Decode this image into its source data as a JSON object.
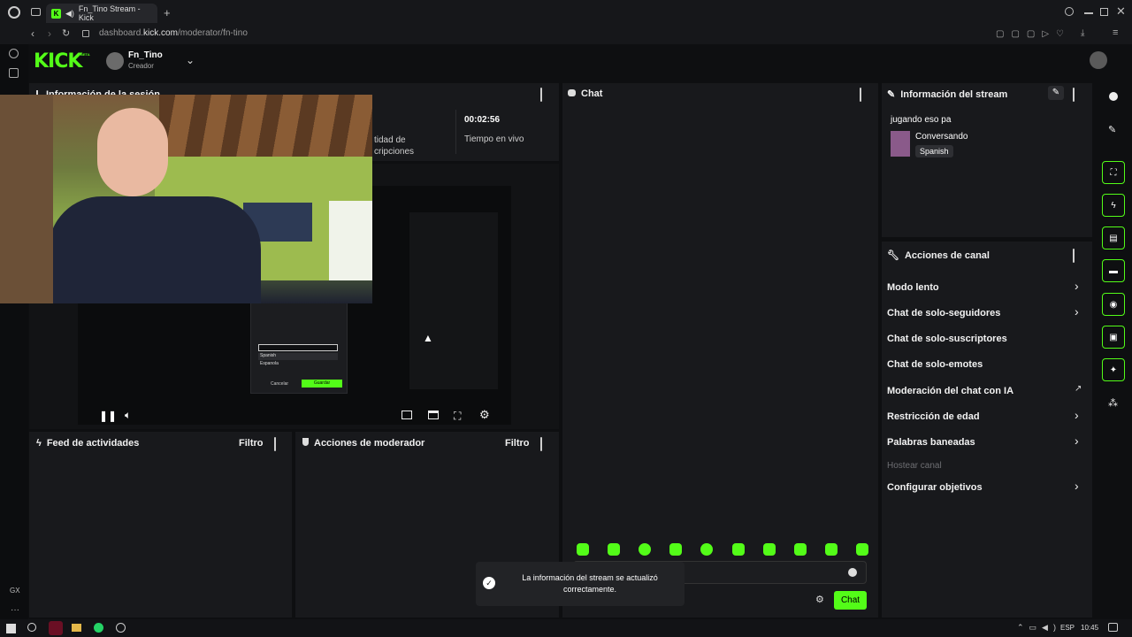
{
  "browser": {
    "tab_title": "Fn_Tino Stream - Kick",
    "new_tab": "+",
    "url_prefix": "dashboard.",
    "url_domain": "kick.com",
    "url_path": "/moderator/fn-tino"
  },
  "header": {
    "logo": "KICK",
    "logo_badge": "BETA",
    "user_name": "Fn_Tino",
    "user_role": "Creador"
  },
  "session": {
    "title": "Información de la sesión",
    "timer": "00:02:56",
    "timer_label": "Tiempo en vivo",
    "subs_label_line1": "tidad de",
    "subs_label_line2": "cripciones"
  },
  "player": {
    "inner_select_value": "Spanish",
    "inner_option_1": "Spanish",
    "inner_option_2": "Espanola",
    "inner_cancel": "Cancelar",
    "inner_save": "Guardar"
  },
  "activity": {
    "title": "Feed de actividades",
    "filter": "Filtro"
  },
  "mod_actions": {
    "title": "Acciones de moderador",
    "filter": "Filtro"
  },
  "chat": {
    "title": "Chat",
    "send_label": "Chat"
  },
  "toast": {
    "line1": "La información del stream se actualizó",
    "line2": "correctamente."
  },
  "stream_info": {
    "title": "Información del stream",
    "stream_title": "jugando eso pa",
    "category": "Conversando",
    "language_tag": "Spanish"
  },
  "channel_actions": {
    "title": "Acciones de canal",
    "items": [
      {
        "label": "Modo lento",
        "control": "chevron"
      },
      {
        "label": "Chat de solo-seguidores",
        "control": "chevron"
      },
      {
        "label": "Chat de solo-suscriptores",
        "control": "toggle"
      },
      {
        "label": "Chat de solo-emotes",
        "control": "toggle"
      },
      {
        "label": "Moderación del chat con IA",
        "control": "external"
      },
      {
        "label": "Restricción de edad",
        "control": "chevron"
      },
      {
        "label": "Palabras baneadas",
        "control": "chevron"
      },
      {
        "label": "Hostear canal",
        "control": "disabled"
      },
      {
        "label": "Configurar objetivos",
        "control": "chevron"
      }
    ]
  },
  "taskbar": {
    "lang": "ESP",
    "time": "10:45"
  },
  "left_rail": {
    "gx": "GX"
  },
  "colors": {
    "accent": "#53fc18",
    "panel": "#18191c",
    "background": "#0e0f11"
  }
}
